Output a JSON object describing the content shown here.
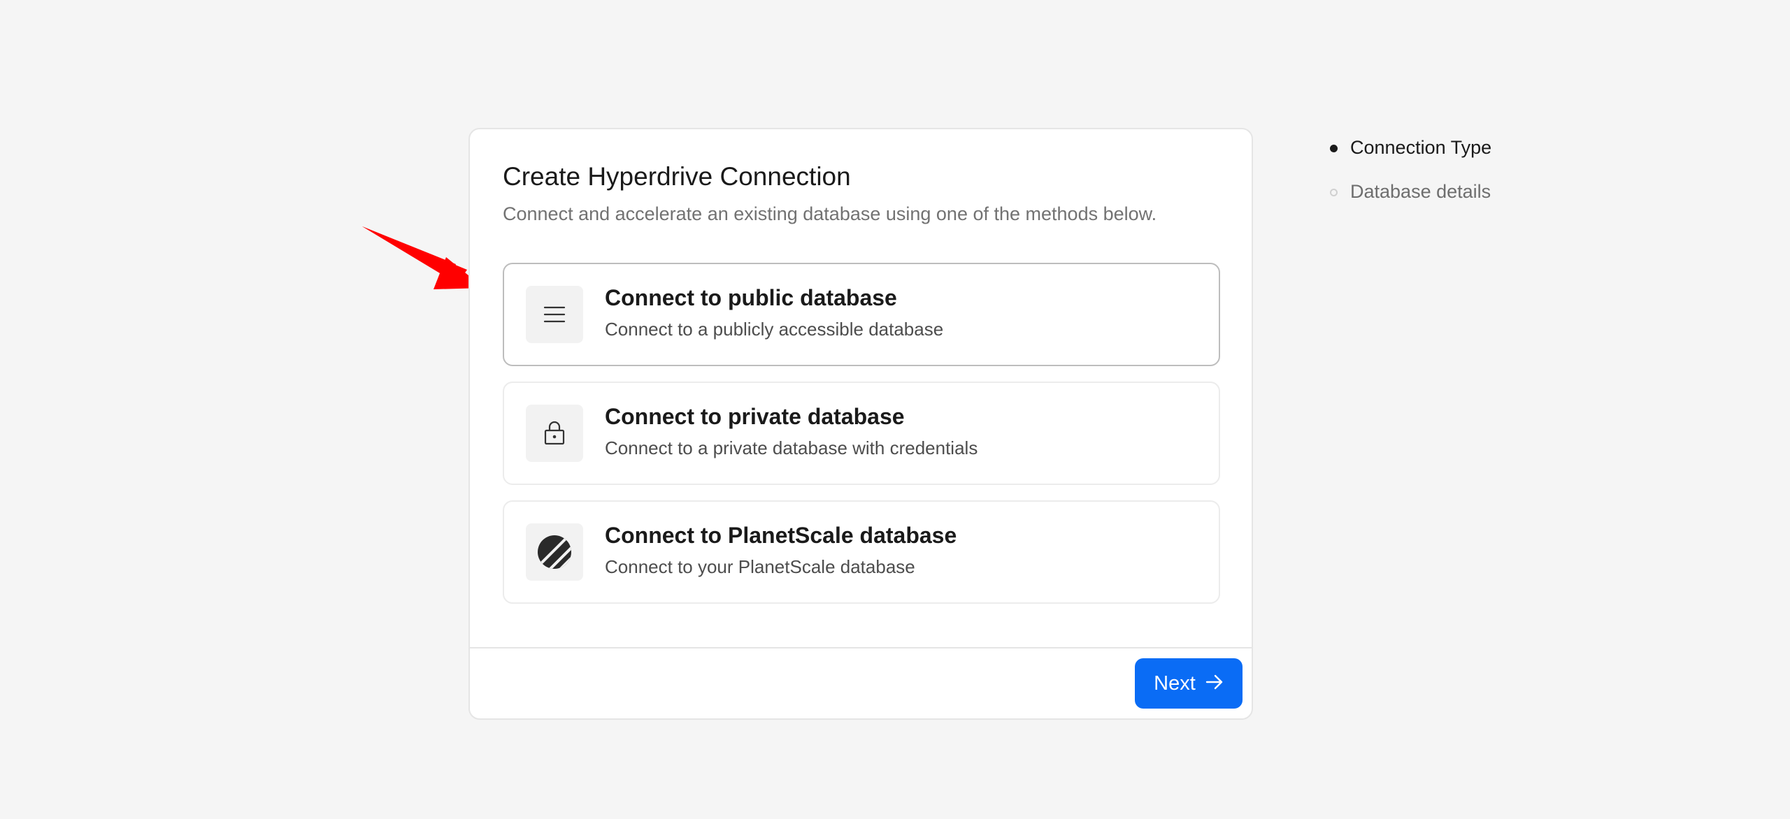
{
  "dialog": {
    "title": "Create Hyperdrive Connection",
    "subtitle": "Connect and accelerate an existing database using one of the methods below."
  },
  "options": [
    {
      "title": "Connect to public database",
      "description": "Connect to a publicly accessible database",
      "icon": "menu-lines-icon",
      "selected": true
    },
    {
      "title": "Connect to private database",
      "description": "Connect to a private database with credentials",
      "icon": "lock-icon",
      "selected": false
    },
    {
      "title": "Connect to PlanetScale database",
      "description": "Connect to your PlanetScale database",
      "icon": "planetscale-logo-icon",
      "selected": false
    }
  ],
  "footer": {
    "next_label": "Next",
    "next_icon": "arrow-right-icon"
  },
  "steps": [
    {
      "label": "Connection Type",
      "state": "active"
    },
    {
      "label": "Database details",
      "state": "inactive"
    }
  ],
  "colors": {
    "accent": "#0a6cf5",
    "annotation_arrow": "#ff0000",
    "background": "#f5f5f5"
  }
}
